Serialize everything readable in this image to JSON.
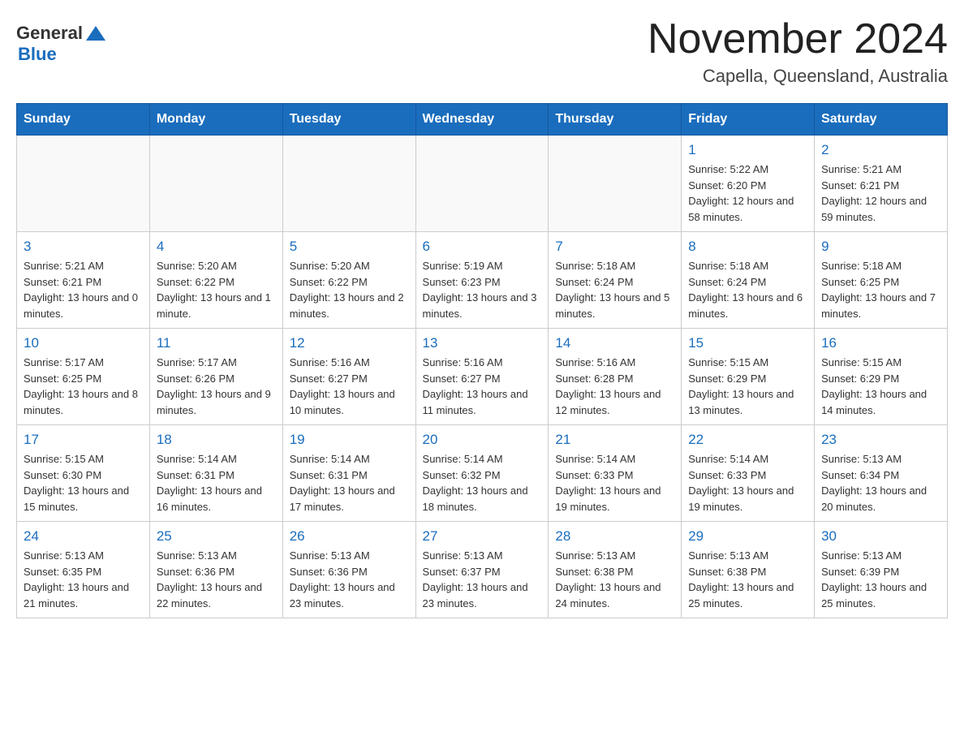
{
  "header": {
    "logo_general": "General",
    "logo_blue": "Blue",
    "month_title": "November 2024",
    "location": "Capella, Queensland, Australia"
  },
  "days_of_week": [
    "Sunday",
    "Monday",
    "Tuesday",
    "Wednesday",
    "Thursday",
    "Friday",
    "Saturday"
  ],
  "weeks": [
    [
      {
        "day": "",
        "info": ""
      },
      {
        "day": "",
        "info": ""
      },
      {
        "day": "",
        "info": ""
      },
      {
        "day": "",
        "info": ""
      },
      {
        "day": "",
        "info": ""
      },
      {
        "day": "1",
        "info": "Sunrise: 5:22 AM\nSunset: 6:20 PM\nDaylight: 12 hours and 58 minutes."
      },
      {
        "day": "2",
        "info": "Sunrise: 5:21 AM\nSunset: 6:21 PM\nDaylight: 12 hours and 59 minutes."
      }
    ],
    [
      {
        "day": "3",
        "info": "Sunrise: 5:21 AM\nSunset: 6:21 PM\nDaylight: 13 hours and 0 minutes."
      },
      {
        "day": "4",
        "info": "Sunrise: 5:20 AM\nSunset: 6:22 PM\nDaylight: 13 hours and 1 minute."
      },
      {
        "day": "5",
        "info": "Sunrise: 5:20 AM\nSunset: 6:22 PM\nDaylight: 13 hours and 2 minutes."
      },
      {
        "day": "6",
        "info": "Sunrise: 5:19 AM\nSunset: 6:23 PM\nDaylight: 13 hours and 3 minutes."
      },
      {
        "day": "7",
        "info": "Sunrise: 5:18 AM\nSunset: 6:24 PM\nDaylight: 13 hours and 5 minutes."
      },
      {
        "day": "8",
        "info": "Sunrise: 5:18 AM\nSunset: 6:24 PM\nDaylight: 13 hours and 6 minutes."
      },
      {
        "day": "9",
        "info": "Sunrise: 5:18 AM\nSunset: 6:25 PM\nDaylight: 13 hours and 7 minutes."
      }
    ],
    [
      {
        "day": "10",
        "info": "Sunrise: 5:17 AM\nSunset: 6:25 PM\nDaylight: 13 hours and 8 minutes."
      },
      {
        "day": "11",
        "info": "Sunrise: 5:17 AM\nSunset: 6:26 PM\nDaylight: 13 hours and 9 minutes."
      },
      {
        "day": "12",
        "info": "Sunrise: 5:16 AM\nSunset: 6:27 PM\nDaylight: 13 hours and 10 minutes."
      },
      {
        "day": "13",
        "info": "Sunrise: 5:16 AM\nSunset: 6:27 PM\nDaylight: 13 hours and 11 minutes."
      },
      {
        "day": "14",
        "info": "Sunrise: 5:16 AM\nSunset: 6:28 PM\nDaylight: 13 hours and 12 minutes."
      },
      {
        "day": "15",
        "info": "Sunrise: 5:15 AM\nSunset: 6:29 PM\nDaylight: 13 hours and 13 minutes."
      },
      {
        "day": "16",
        "info": "Sunrise: 5:15 AM\nSunset: 6:29 PM\nDaylight: 13 hours and 14 minutes."
      }
    ],
    [
      {
        "day": "17",
        "info": "Sunrise: 5:15 AM\nSunset: 6:30 PM\nDaylight: 13 hours and 15 minutes."
      },
      {
        "day": "18",
        "info": "Sunrise: 5:14 AM\nSunset: 6:31 PM\nDaylight: 13 hours and 16 minutes."
      },
      {
        "day": "19",
        "info": "Sunrise: 5:14 AM\nSunset: 6:31 PM\nDaylight: 13 hours and 17 minutes."
      },
      {
        "day": "20",
        "info": "Sunrise: 5:14 AM\nSunset: 6:32 PM\nDaylight: 13 hours and 18 minutes."
      },
      {
        "day": "21",
        "info": "Sunrise: 5:14 AM\nSunset: 6:33 PM\nDaylight: 13 hours and 19 minutes."
      },
      {
        "day": "22",
        "info": "Sunrise: 5:14 AM\nSunset: 6:33 PM\nDaylight: 13 hours and 19 minutes."
      },
      {
        "day": "23",
        "info": "Sunrise: 5:13 AM\nSunset: 6:34 PM\nDaylight: 13 hours and 20 minutes."
      }
    ],
    [
      {
        "day": "24",
        "info": "Sunrise: 5:13 AM\nSunset: 6:35 PM\nDaylight: 13 hours and 21 minutes."
      },
      {
        "day": "25",
        "info": "Sunrise: 5:13 AM\nSunset: 6:36 PM\nDaylight: 13 hours and 22 minutes."
      },
      {
        "day": "26",
        "info": "Sunrise: 5:13 AM\nSunset: 6:36 PM\nDaylight: 13 hours and 23 minutes."
      },
      {
        "day": "27",
        "info": "Sunrise: 5:13 AM\nSunset: 6:37 PM\nDaylight: 13 hours and 23 minutes."
      },
      {
        "day": "28",
        "info": "Sunrise: 5:13 AM\nSunset: 6:38 PM\nDaylight: 13 hours and 24 minutes."
      },
      {
        "day": "29",
        "info": "Sunrise: 5:13 AM\nSunset: 6:38 PM\nDaylight: 13 hours and 25 minutes."
      },
      {
        "day": "30",
        "info": "Sunrise: 5:13 AM\nSunset: 6:39 PM\nDaylight: 13 hours and 25 minutes."
      }
    ]
  ]
}
